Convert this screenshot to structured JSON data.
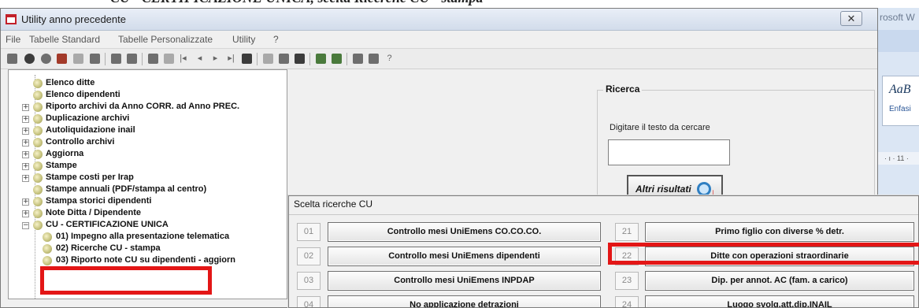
{
  "banner": {
    "text": "CU - CERTIFICAZIONE UNICA, scelta Ricerche CU - stampa"
  },
  "background_app": {
    "title": "rosoft W",
    "style_sample": "AaB",
    "style_name": "Enfasi",
    "ruler": "· ı · 11 ·"
  },
  "window": {
    "title": "Utility anno precedente",
    "close_glyph": "✕",
    "menu": [
      "File",
      "Tabelle Standard",
      "Tabelle Personalizzate",
      "Utility",
      "?"
    ]
  },
  "toolbar_icons": [
    "save-icon",
    "record-icon",
    "undo-icon",
    "chart-icon",
    "document-icon",
    "folder-icon",
    "print-icon",
    "print-preview-icon",
    "binoculars-icon",
    "find-icon",
    "first-icon",
    "prev-icon",
    "next-icon",
    "last-icon",
    "grid-icon",
    "form-icon",
    "table-icon",
    "monitor-icon",
    "copy-icon",
    "paste-icon",
    "export-icon",
    "tools-icon",
    "help-icon"
  ],
  "tree": {
    "items": [
      {
        "label": "Elenco ditte",
        "expandable": false
      },
      {
        "label": "Elenco dipendenti",
        "expandable": false
      },
      {
        "label": "Riporto archivi da Anno CORR. ad Anno PREC.",
        "expandable": true
      },
      {
        "label": "Duplicazione archivi",
        "expandable": true
      },
      {
        "label": "Autoliquidazione inail",
        "expandable": true
      },
      {
        "label": "Controllo archivi",
        "expandable": true
      },
      {
        "label": "Aggiorna",
        "expandable": true
      },
      {
        "label": "Stampe",
        "expandable": true
      },
      {
        "label": "Stampe costi per Irap",
        "expandable": true
      },
      {
        "label": "Stampe annuali  (PDF/stampa al centro)",
        "expandable": false
      },
      {
        "label": "Stampa storici dipendenti",
        "expandable": true
      },
      {
        "label": "Note Ditta / Dipendente",
        "expandable": true
      },
      {
        "label": "CU - CERTIFICAZIONE UNICA",
        "expandable": true,
        "expanded": true
      },
      {
        "label": "01) Impegno alla presentazione telematica",
        "expandable": false,
        "child": true
      },
      {
        "label": "02) Ricerche CU - stampa",
        "expandable": false,
        "child": true
      },
      {
        "label": "03) Riporto note CU su dipendenti - aggiorn",
        "expandable": false,
        "child": true
      }
    ]
  },
  "ricerca": {
    "legend": "Ricerca",
    "hint": "Digitare il testo da cercare",
    "search_value": "",
    "more_button": "Altri risultati"
  },
  "dialog": {
    "title": "Scelta ricerche CU",
    "left_rows": [
      {
        "num": "01",
        "label": "Controllo mesi UniEmens CO.CO.CO."
      },
      {
        "num": "02",
        "label": "Controllo mesi UniEmens dipendenti"
      },
      {
        "num": "03",
        "label": "Controllo mesi UniEmens INPDAP"
      },
      {
        "num": "04",
        "label": "No applicazione detrazioni"
      }
    ],
    "right_rows": [
      {
        "num": "21",
        "label": "Primo figlio con diverse % detr."
      },
      {
        "num": "22",
        "label": "Ditte con operazioni straordinarie"
      },
      {
        "num": "23",
        "label": "Dip. per annot. AC (fam. a carico)"
      },
      {
        "num": "24",
        "label": "Luogo svolg.att.dip.INAIL"
      }
    ]
  },
  "colors": {
    "highlight": "#e31616",
    "title_gradient_top": "#e9eef7",
    "window_bg": "#f0f0f0"
  }
}
